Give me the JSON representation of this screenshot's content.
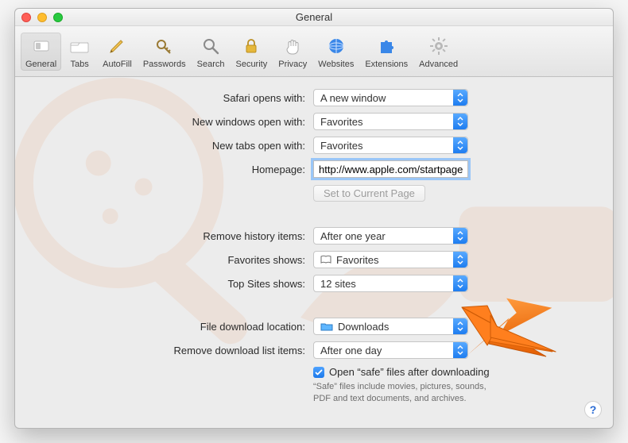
{
  "window": {
    "title": "General"
  },
  "toolbar": {
    "items": [
      {
        "id": "general",
        "label": "General"
      },
      {
        "id": "tabs",
        "label": "Tabs"
      },
      {
        "id": "autofill",
        "label": "AutoFill"
      },
      {
        "id": "passwords",
        "label": "Passwords"
      },
      {
        "id": "search",
        "label": "Search"
      },
      {
        "id": "security",
        "label": "Security"
      },
      {
        "id": "privacy",
        "label": "Privacy"
      },
      {
        "id": "websites",
        "label": "Websites"
      },
      {
        "id": "extensions",
        "label": "Extensions"
      },
      {
        "id": "advanced",
        "label": "Advanced"
      }
    ]
  },
  "form": {
    "safariOpensWith": {
      "label": "Safari opens with:",
      "value": "A new window"
    },
    "newWindowsOpenWith": {
      "label": "New windows open with:",
      "value": "Favorites"
    },
    "newTabsOpenWith": {
      "label": "New tabs open with:",
      "value": "Favorites"
    },
    "homepage": {
      "label": "Homepage:",
      "value": "http://www.apple.com/startpage/"
    },
    "setCurrentPage": {
      "label": "Set to Current Page"
    },
    "removeHistory": {
      "label": "Remove history items:",
      "value": "After one year"
    },
    "favoritesShows": {
      "label": "Favorites shows:",
      "value": "Favorites"
    },
    "topSitesShows": {
      "label": "Top Sites shows:",
      "value": "12 sites"
    },
    "fileDownloadLoc": {
      "label": "File download location:",
      "value": "Downloads"
    },
    "removeDownloads": {
      "label": "Remove download list items:",
      "value": "After one day"
    },
    "openSafeFiles": {
      "label": "Open “safe” files after downloading",
      "checked": true
    },
    "safeFilesHelp": "“Safe” files include movies, pictures, sounds, PDF and text documents, and archives."
  },
  "help": {
    "symbol": "?"
  }
}
